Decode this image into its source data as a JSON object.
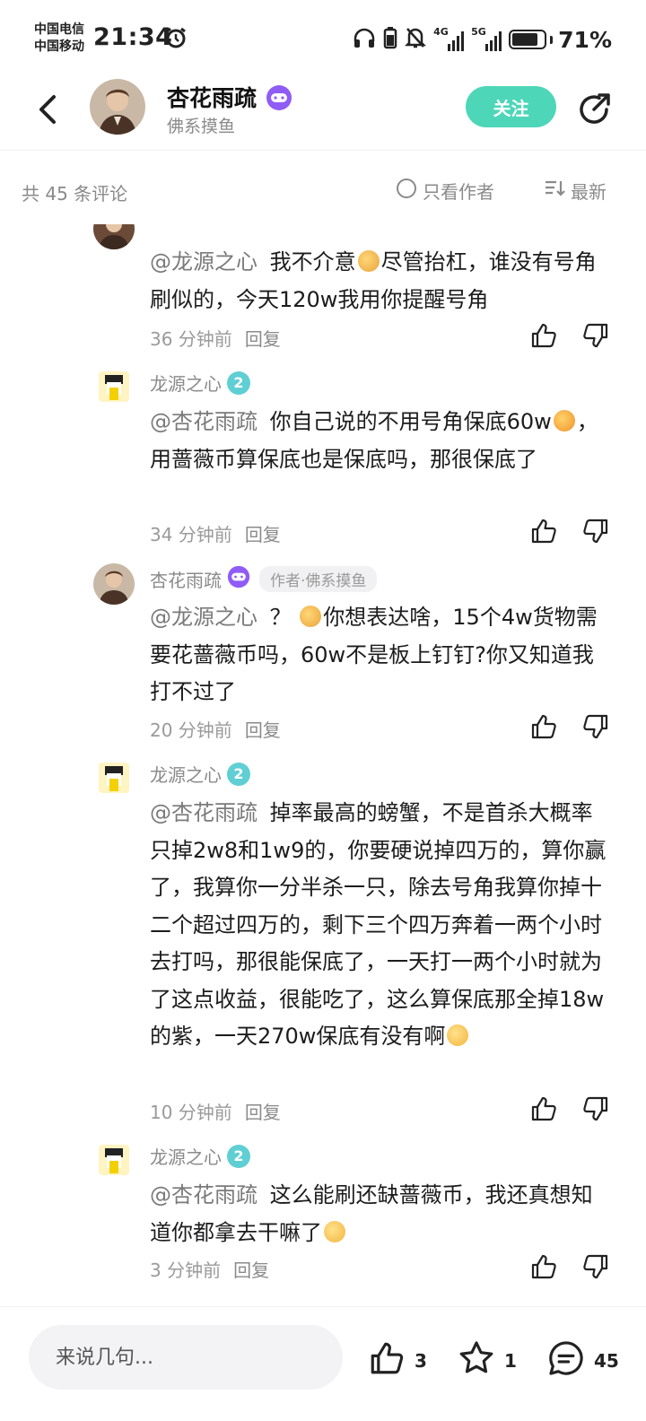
{
  "status": {
    "carrier1": "中国电信",
    "carrier2": "中国移动",
    "time": "21:34",
    "net1": "4G",
    "net2": "5G",
    "battery": "71%"
  },
  "header": {
    "name": "杏花雨疏",
    "subtitle": "佛系摸鱼",
    "follow_label": "关注"
  },
  "sortbar": {
    "total": "共 45 条评论",
    "only_author": "只看作者",
    "latest": "最新"
  },
  "comments": [
    {
      "mention": "@龙源之心",
      "text_a": "我不介意",
      "text_b": "尽管抬杠，谁没有号角刷似的，今天120w我用你提醒号角",
      "time": "36 分钟前",
      "reply": "回复"
    },
    {
      "name": "龙源之心",
      "level": "2",
      "mention": "@杏花雨疏",
      "text_a": "你自己说的不用号角保底60w",
      "text_b": "，用蔷薇币算保底也是保底吗，那很保底了",
      "time": "34 分钟前",
      "reply": "回复"
    },
    {
      "name": "杏花雨疏",
      "tag": "作者·佛系摸鱼",
      "mention": "@龙源之心",
      "text_a": "？",
      "text_b": "你想表达啥，15个4w货物需要花蔷薇币吗，60w不是板上钉钉?你又知道我打不过了",
      "time": "20 分钟前",
      "reply": "回复"
    },
    {
      "name": "龙源之心",
      "level": "2",
      "mention": "@杏花雨疏",
      "text_a": "掉率最高的螃蟹，不是首杀大概率只掉2w8和1w9的，你要硬说掉四万的，算你赢了，我算你一分半杀一只，除去号角我算你掉十二个超过四万的，剩下三个四万奔着一两个小时去打吗，那很能保底了，一天打一两个小时就为了这点收益，很能吃了，这么算保底那全掉18w的紫，一天270w保底有没有啊",
      "time": "10 分钟前",
      "reply": "回复"
    },
    {
      "name": "龙源之心",
      "level": "2",
      "mention": "@杏花雨疏",
      "text_a": "这么能刷还缺蔷薇币，我还真想知道你都拿去干嘛了",
      "time": "3 分钟前",
      "reply": "回复"
    }
  ],
  "bottom": {
    "placeholder": "来说几句...",
    "likes": "3",
    "favorites": "1",
    "comments": "45"
  },
  "colors": {
    "accent": "#4dd6b8",
    "level_badge": "#5fcfd4",
    "author_badge": "#8f5cf6"
  }
}
